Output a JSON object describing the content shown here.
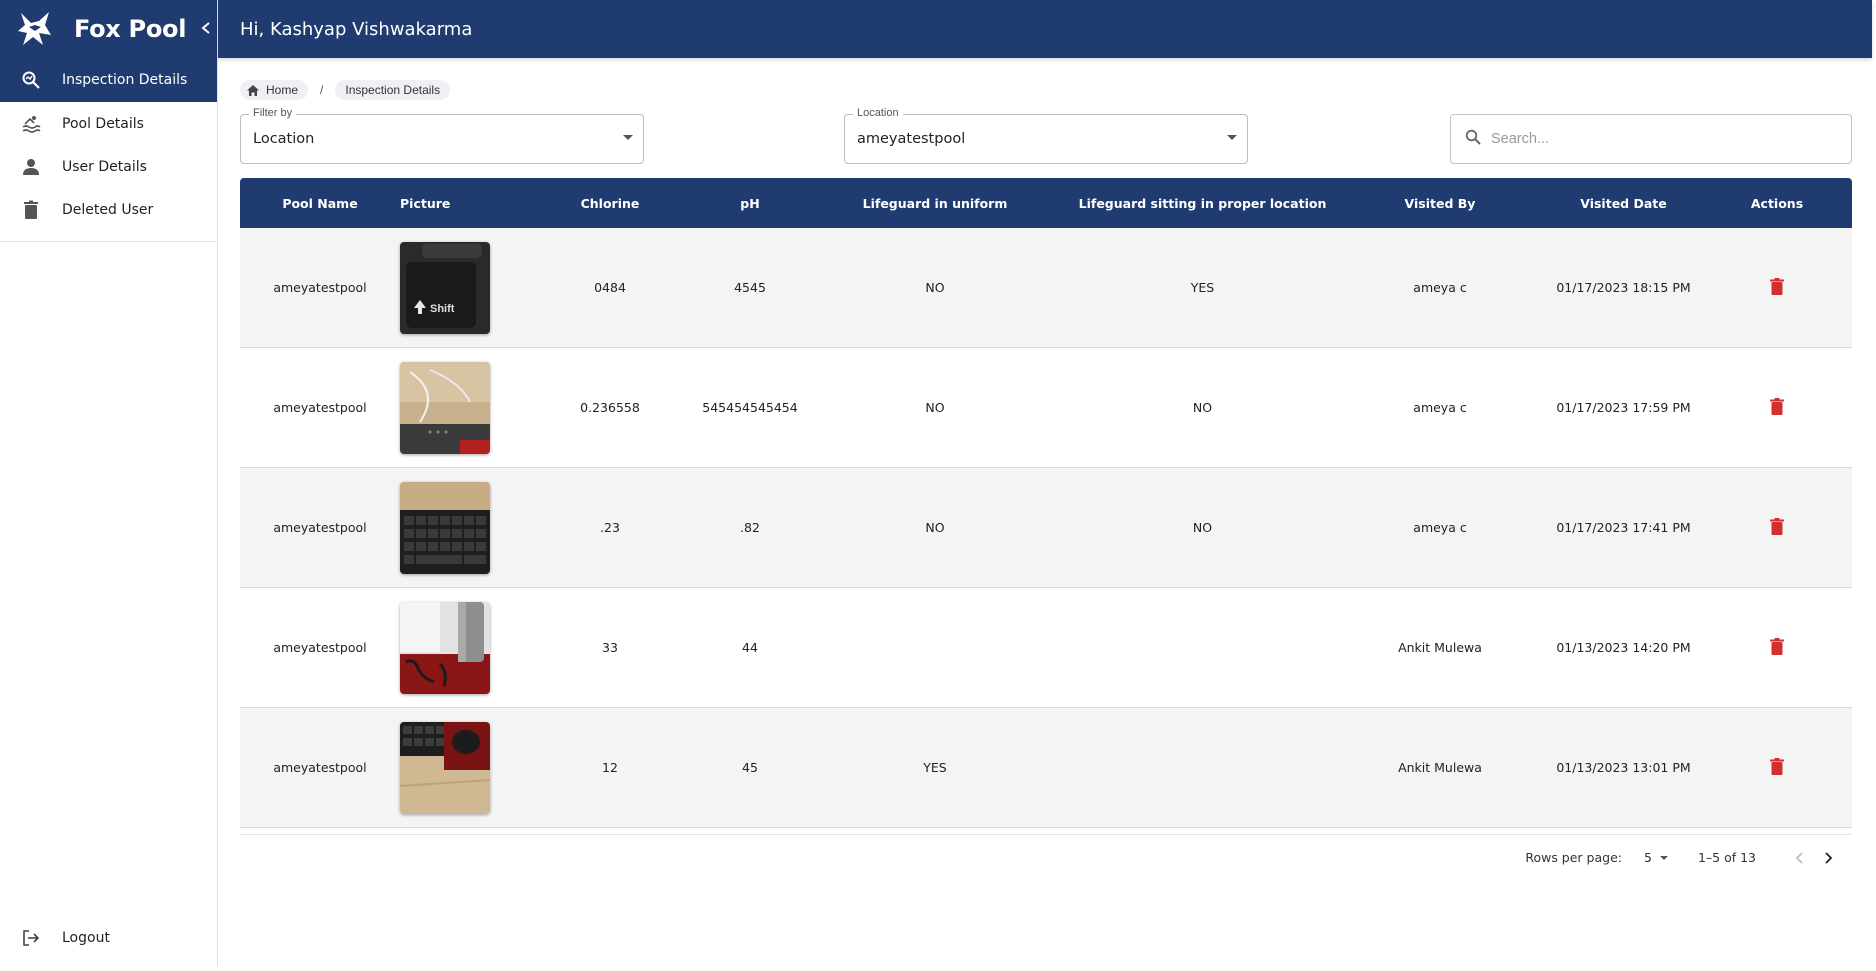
{
  "app": {
    "name": "Fox Pool",
    "greeting": "Hi, Kashyap Vishwakarma",
    "accent": "#1f3b70",
    "danger": "#d32f2f"
  },
  "sidebar": {
    "items": [
      {
        "label": "Inspection Details",
        "icon": "inspection-search-icon",
        "active": true
      },
      {
        "label": "Pool Details",
        "icon": "pool-icon",
        "active": false
      },
      {
        "label": "User Details",
        "icon": "person-icon",
        "active": false
      },
      {
        "label": "Deleted User",
        "icon": "trash-icon",
        "active": false
      }
    ],
    "logout_label": "Logout"
  },
  "breadcrumb": {
    "home": "Home",
    "current": "Inspection Details"
  },
  "filters": {
    "filter_by": {
      "legend": "Filter by",
      "value": "Location"
    },
    "location": {
      "legend": "Location",
      "value": "ameyatestpool"
    },
    "search_placeholder": "Search..."
  },
  "table": {
    "columns": [
      "Pool Name",
      "Picture",
      "Chlorine",
      "pH",
      "Lifeguard in uniform",
      "Lifeguard sitting in proper location",
      "Visited By",
      "Visited Date",
      "Actions"
    ],
    "rows": [
      {
        "pool": "ameyatestpool",
        "picture": "photo-keyboard-shift-key",
        "chlorine": "0484",
        "ph": "4545",
        "uniform": "NO",
        "location": "YES",
        "visited_by": "ameya c",
        "date": "01/17/2023 18:15 PM"
      },
      {
        "pool": "ameyatestpool",
        "picture": "photo-desk-device",
        "chlorine": "0.236558",
        "ph": "545454545454",
        "uniform": "NO",
        "location": "NO",
        "visited_by": "ameya c",
        "date": "01/17/2023 17:59 PM"
      },
      {
        "pool": "ameyatestpool",
        "picture": "photo-keyboard",
        "chlorine": ".23",
        "ph": ".82",
        "uniform": "NO",
        "location": "NO",
        "visited_by": "ameya c",
        "date": "01/17/2023 17:41 PM"
      },
      {
        "pool": "ameyatestpool",
        "picture": "photo-bottle-mousepad",
        "chlorine": "33",
        "ph": "44",
        "uniform": "",
        "location": "",
        "visited_by": "Ankit Mulewa",
        "date": "01/13/2023 14:20 PM"
      },
      {
        "pool": "ameyatestpool",
        "picture": "photo-keyboard-mouse",
        "chlorine": "12",
        "ph": "45",
        "uniform": "YES",
        "location": "",
        "visited_by": "Ankit Mulewa",
        "date": "01/13/2023 13:01 PM"
      }
    ]
  },
  "pagination": {
    "rows_per_page_label": "Rows per page:",
    "rows_per_page": "5",
    "range": "1–5 of 13"
  }
}
